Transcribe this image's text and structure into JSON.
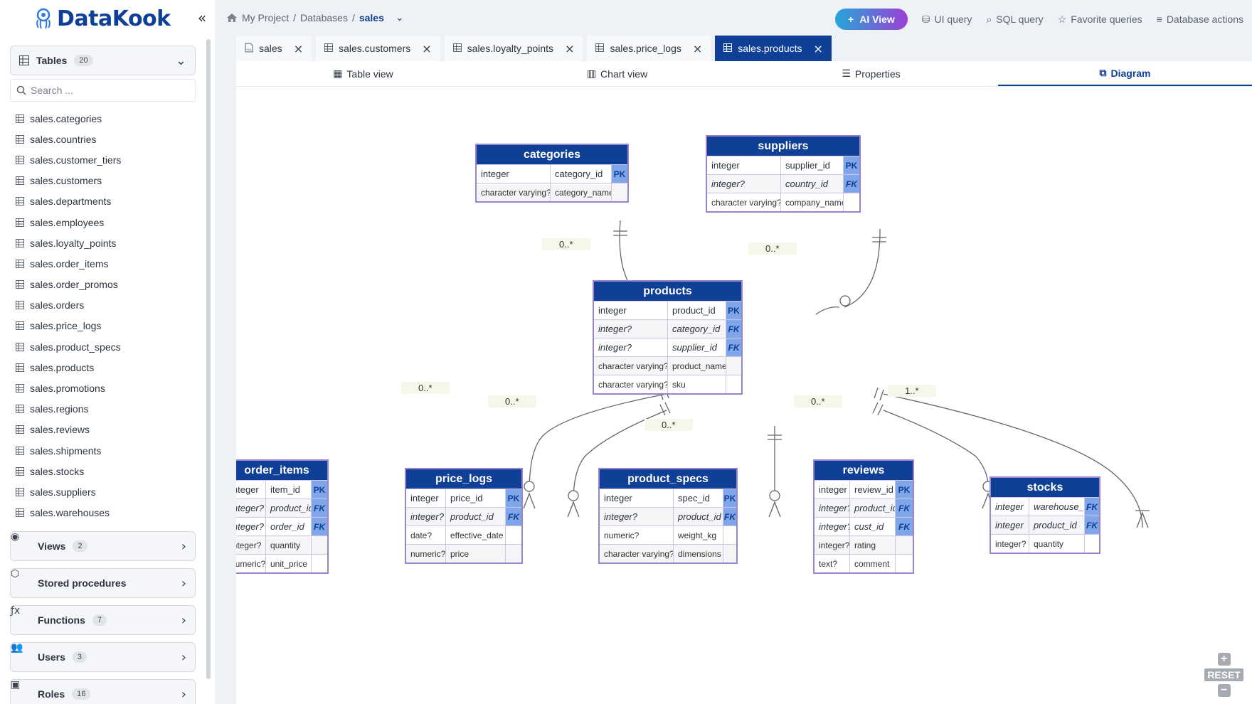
{
  "app": {
    "name": "DataKook"
  },
  "sidebar": {
    "tables_section": {
      "label": "Tables",
      "count": "20"
    },
    "search_placeholder": "Search ...",
    "tables": [
      "sales.categories",
      "sales.countries",
      "sales.customer_tiers",
      "sales.customers",
      "sales.departments",
      "sales.employees",
      "sales.loyalty_points",
      "sales.order_items",
      "sales.order_promos",
      "sales.orders",
      "sales.price_logs",
      "sales.product_specs",
      "sales.products",
      "sales.promotions",
      "sales.regions",
      "sales.reviews",
      "sales.shipments",
      "sales.stocks",
      "sales.suppliers",
      "sales.warehouses"
    ],
    "sections": [
      {
        "label": "Views",
        "count": "2",
        "icon": "eye-icon"
      },
      {
        "label": "Stored procedures",
        "count": "",
        "icon": "cube-icon"
      },
      {
        "label": "Functions",
        "count": "7",
        "icon": "function-icon"
      },
      {
        "label": "Users",
        "count": "3",
        "icon": "users-icon"
      },
      {
        "label": "Roles",
        "count": "16",
        "icon": "roles-icon"
      }
    ]
  },
  "breadcrumb": {
    "project": "My Project",
    "databases": "Databases",
    "current": "sales"
  },
  "actions": {
    "ai_view": "AI View",
    "ui_query": "UI query",
    "sql_query": "SQL query",
    "favorite_queries": "Favorite queries",
    "database_actions": "Database actions"
  },
  "tabs": [
    {
      "label": "sales",
      "icon": "sql-icon",
      "active": false
    },
    {
      "label": "sales.customers",
      "icon": "table-icon",
      "active": false
    },
    {
      "label": "sales.loyalty_points",
      "icon": "table-icon",
      "active": false
    },
    {
      "label": "sales.price_logs",
      "icon": "table-icon",
      "active": false
    },
    {
      "label": "sales.products",
      "icon": "table-icon",
      "active": true
    }
  ],
  "subtabs": [
    {
      "label": "Table view",
      "active": false
    },
    {
      "label": "Chart view",
      "active": false
    },
    {
      "label": "Properties",
      "active": false
    },
    {
      "label": "Diagram",
      "active": true
    }
  ],
  "diagram": {
    "entities": {
      "categories": {
        "title": "categories",
        "rows": [
          {
            "type": "integer",
            "name": "category_id",
            "key": "PK"
          },
          {
            "type": "character varying?",
            "name": "category_name",
            "key": ""
          }
        ]
      },
      "suppliers": {
        "title": "suppliers",
        "rows": [
          {
            "type": "integer",
            "name": "supplier_id",
            "key": "PK"
          },
          {
            "type": "integer?",
            "name": "country_id",
            "key": "FK"
          },
          {
            "type": "character varying?",
            "name": "company_name",
            "key": ""
          }
        ]
      },
      "products": {
        "title": "products",
        "rows": [
          {
            "type": "integer",
            "name": "product_id",
            "key": "PK"
          },
          {
            "type": "integer?",
            "name": "category_id",
            "key": "FK"
          },
          {
            "type": "integer?",
            "name": "supplier_id",
            "key": "FK"
          },
          {
            "type": "character varying?",
            "name": "product_name",
            "key": ""
          },
          {
            "type": "character varying?",
            "name": "sku",
            "key": ""
          }
        ]
      },
      "order_items": {
        "title": "order_items",
        "rows": [
          {
            "type": "integer",
            "name": "item_id",
            "key": "PK"
          },
          {
            "type": "integer?",
            "name": "product_id",
            "key": "FK"
          },
          {
            "type": "integer?",
            "name": "order_id",
            "key": "FK"
          },
          {
            "type": "integer?",
            "name": "quantity",
            "key": ""
          },
          {
            "type": "numeric?",
            "name": "unit_price",
            "key": ""
          }
        ]
      },
      "price_logs": {
        "title": "price_logs",
        "rows": [
          {
            "type": "integer",
            "name": "price_id",
            "key": "PK"
          },
          {
            "type": "integer?",
            "name": "product_id",
            "key": "FK"
          },
          {
            "type": "date?",
            "name": "effective_date",
            "key": ""
          },
          {
            "type": "numeric?",
            "name": "price",
            "key": ""
          }
        ]
      },
      "product_specs": {
        "title": "product_specs",
        "rows": [
          {
            "type": "integer",
            "name": "spec_id",
            "key": "PK"
          },
          {
            "type": "integer?",
            "name": "product_id",
            "key": "FK"
          },
          {
            "type": "numeric?",
            "name": "weight_kg",
            "key": ""
          },
          {
            "type": "character varying?",
            "name": "dimensions",
            "key": ""
          }
        ]
      },
      "reviews": {
        "title": "reviews",
        "rows": [
          {
            "type": "integer",
            "name": "review_id",
            "key": "PK"
          },
          {
            "type": "integer?",
            "name": "product_id",
            "key": "FK"
          },
          {
            "type": "integer?",
            "name": "cust_id",
            "key": "FK"
          },
          {
            "type": "integer?",
            "name": "rating",
            "key": ""
          },
          {
            "type": "text?",
            "name": "comment",
            "key": ""
          }
        ]
      },
      "stocks": {
        "title": "stocks",
        "rows": [
          {
            "type": "integer",
            "name": "warehouse_id",
            "key": "FK"
          },
          {
            "type": "integer",
            "name": "product_id",
            "key": "FK"
          },
          {
            "type": "integer?",
            "name": "quantity",
            "key": ""
          }
        ]
      }
    },
    "cardinalities": {
      "categories": "0..*",
      "suppliers": "0..*",
      "order_items": "0..*",
      "price_logs": "0..*",
      "product_specs": "0..*",
      "reviews": "0..*",
      "stocks": "1..*"
    },
    "zoom_reset": "RESET"
  }
}
